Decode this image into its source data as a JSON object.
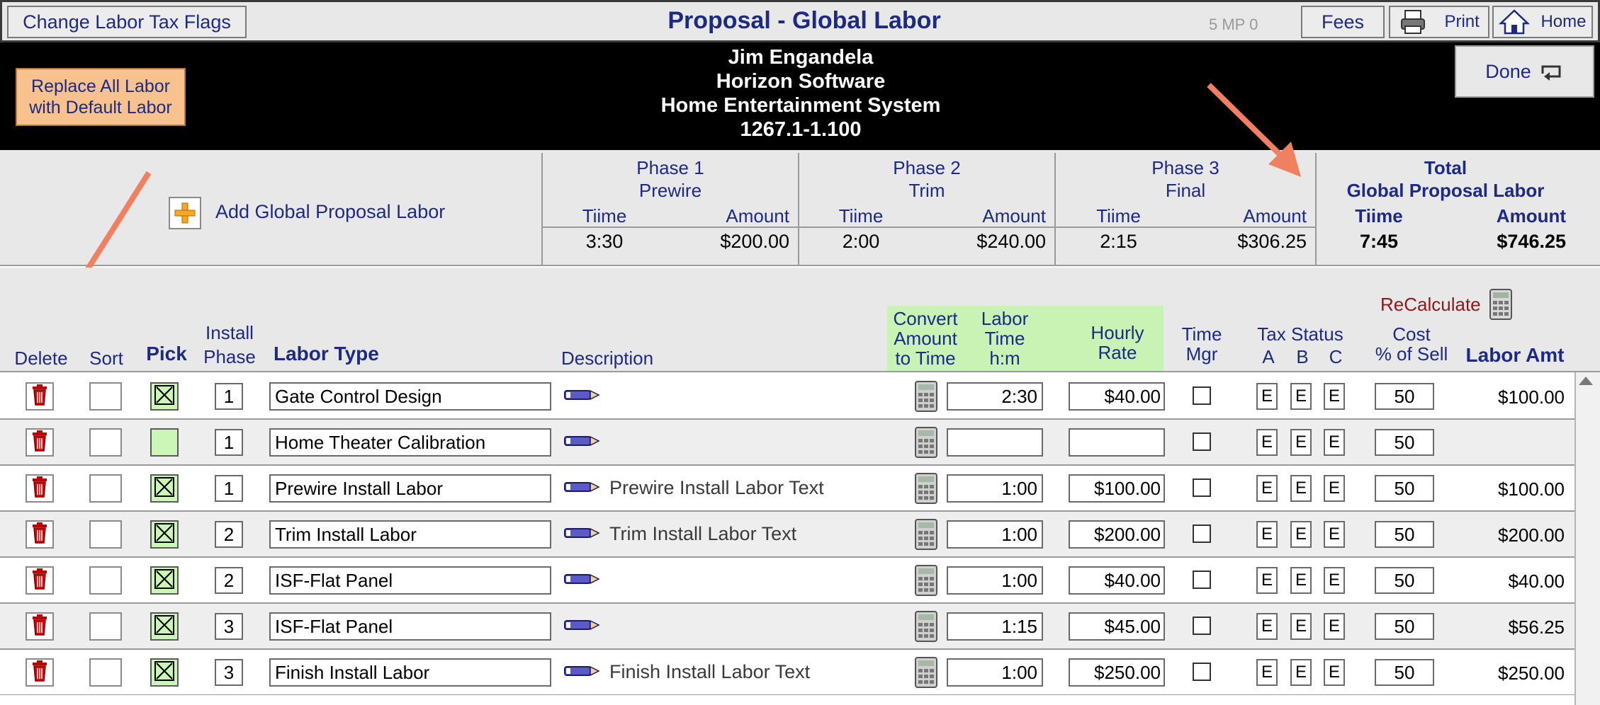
{
  "toolbar": {
    "change_tax_flags": "Change Labor Tax Flags",
    "title": "Proposal - Global Labor",
    "mp_indicator": "5  MP 0",
    "fees": "Fees",
    "print": "Print",
    "home": "Home",
    "done": "Done"
  },
  "customer": {
    "name": "Jim Engandela",
    "company": "Horizon Software",
    "project": "Home Entertainment System",
    "proposal_number": "1267.1-1.100"
  },
  "replace_button": {
    "line1": "Replace All Labor",
    "line2": "with Default Labor"
  },
  "add_labor": "Add Global Proposal Labor",
  "phases": [
    {
      "name": "Phase 1",
      "sub": "Prewire",
      "time_label": "Tiime",
      "amount_label": "Amount",
      "time": "3:30",
      "amount": "$200.00"
    },
    {
      "name": "Phase 2",
      "sub": "Trim",
      "time_label": "Tiime",
      "amount_label": "Amount",
      "time": "2:00",
      "amount": "$240.00"
    },
    {
      "name": "Phase 3",
      "sub": "Final",
      "time_label": "Tiime",
      "amount_label": "Amount",
      "time": "2:15",
      "amount": "$306.25"
    }
  ],
  "total": {
    "line1": "Total",
    "line2": "Global Proposal Labor",
    "time_label": "Tiime",
    "amount_label": "Amount",
    "time": "7:45",
    "amount": "$746.25"
  },
  "recalculate": "ReCalculate",
  "columns": {
    "delete": "Delete",
    "sort": "Sort",
    "pick": "Pick",
    "install_phase_1": "Install",
    "install_phase_2": "Phase",
    "labor_type": "Labor Type",
    "description": "Description",
    "convert_1": "Convert",
    "convert_2": "Amount",
    "convert_3": "to Time",
    "labor_time_1": "Labor",
    "labor_time_2": "Time",
    "labor_time_3": "h:m",
    "hourly_1": "Hourly",
    "hourly_2": "Rate",
    "time_mgr_1": "Time",
    "time_mgr_2": "Mgr",
    "tax_status": "Tax Status",
    "tax_a": "A",
    "tax_b": "B",
    "tax_c": "C",
    "cost_1": "Cost",
    "cost_2": "% of Sell",
    "labor_amt": "Labor Amt"
  },
  "rows": [
    {
      "picked": true,
      "phase": "1",
      "labor_type": "Gate Control Design",
      "description": "",
      "time": "2:30",
      "rate": "$40.00",
      "tax": [
        "E",
        "E",
        "E"
      ],
      "cost": "50",
      "amount": "$100.00"
    },
    {
      "picked": false,
      "phase": "1",
      "labor_type": "Home Theater Calibration",
      "description": "",
      "time": "",
      "rate": "",
      "tax": [
        "E",
        "E",
        "E"
      ],
      "cost": "50",
      "amount": ""
    },
    {
      "picked": true,
      "phase": "1",
      "labor_type": "Prewire Install Labor",
      "description": "Prewire Install Labor Text",
      "time": "1:00",
      "rate": "$100.00",
      "tax": [
        "E",
        "E",
        "E"
      ],
      "cost": "50",
      "amount": "$100.00"
    },
    {
      "picked": true,
      "phase": "2",
      "labor_type": "Trim Install Labor",
      "description": "Trim Install Labor Text",
      "time": "1:00",
      "rate": "$200.00",
      "tax": [
        "E",
        "E",
        "E"
      ],
      "cost": "50",
      "amount": "$200.00"
    },
    {
      "picked": true,
      "phase": "2",
      "labor_type": "ISF-Flat Panel",
      "description": "",
      "time": "1:00",
      "rate": "$40.00",
      "tax": [
        "E",
        "E",
        "E"
      ],
      "cost": "50",
      "amount": "$40.00"
    },
    {
      "picked": true,
      "phase": "3",
      "labor_type": "ISF-Flat Panel",
      "description": "",
      "time": "1:15",
      "rate": "$45.00",
      "tax": [
        "E",
        "E",
        "E"
      ],
      "cost": "50",
      "amount": "$56.25"
    },
    {
      "picked": true,
      "phase": "3",
      "labor_type": "Finish Install Labor",
      "description": "Finish Install Labor Text",
      "time": "1:00",
      "rate": "$250.00",
      "tax": [
        "E",
        "E",
        "E"
      ],
      "cost": "50",
      "amount": "$250.00"
    }
  ],
  "colors": {
    "accent_orange": "#f08060",
    "pick_green": "#ccf5b8",
    "header_blue": "#1c2a86",
    "recalc_red": "#8b1a1a"
  }
}
